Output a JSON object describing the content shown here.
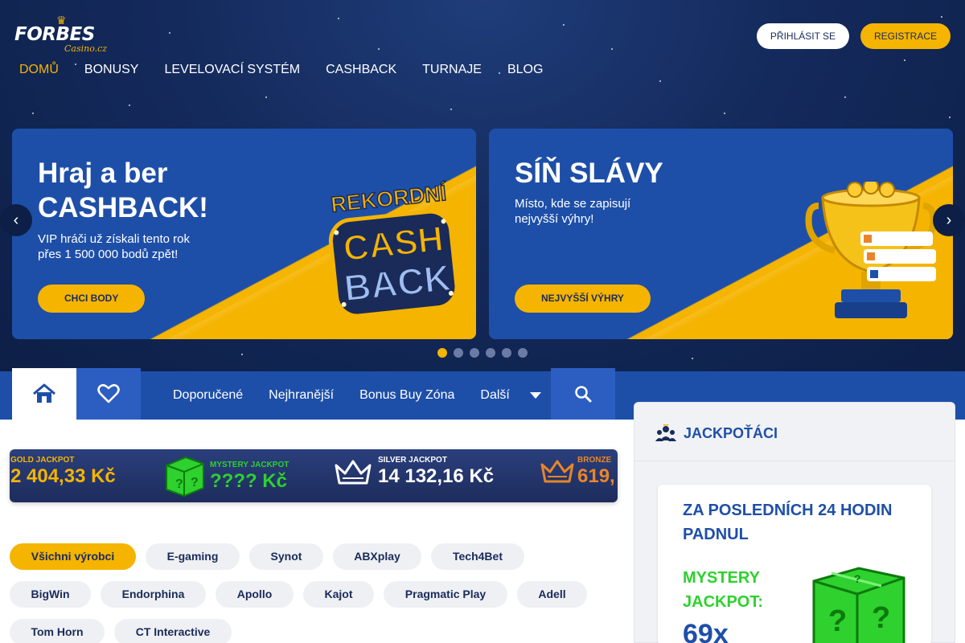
{
  "header": {
    "logo_brand": "FORBES",
    "logo_sub": "Casino.cz",
    "login_label": "PŘIHLÁSIT SE",
    "register_label": "REGISTRACE"
  },
  "nav": {
    "items": [
      "DOMŮ",
      "BONUSY",
      "LEVELOVACÍ SYSTÉM",
      "CASHBACK",
      "TURNAJE",
      "BLOG"
    ],
    "active": "DOMŮ"
  },
  "banners": [
    {
      "title_line1": "Hraj a ber",
      "title_line2": "CASHBACK!",
      "text_line1": "VIP hráči už získali tento rok",
      "text_line2": "přes 1 500 000 bodů zpět!",
      "cta": "CHCI BODY",
      "art_text_top": "REKORDNÍ",
      "art_text_mid": "CASH",
      "art_text_bot": "BACK"
    },
    {
      "title_line1": "SÍŇ SLÁVY",
      "text_line1": "Místo, kde se zapisují",
      "text_line2": "nejvyšší výhry!",
      "cta": "NEJVYŠŠÍ VÝHRY"
    }
  ],
  "carousel": {
    "dot_count": 6,
    "active_index": 0
  },
  "categories": {
    "links": [
      "Doporučené",
      "Nejhranější",
      "Bonus Buy Zóna"
    ],
    "more_label": "Další"
  },
  "jackpots": [
    {
      "label": "GOLD JACKPOT",
      "value": "2 404,33 Kč",
      "label_color": "#f5b400",
      "value_color": "#f5b400"
    },
    {
      "label": "MYSTERY JACKPOT",
      "value": "???? Kč",
      "label_color": "#2ed12e",
      "value_color": "#2ed12e"
    },
    {
      "label": "SILVER JACKPOT",
      "value": "14 132,16 Kč",
      "label_color": "#ffffff",
      "value_color": "#ffffff"
    },
    {
      "label": "BRONZE",
      "value": "619,",
      "label_color": "#e8852a",
      "value_color": "#e8852a"
    }
  ],
  "providers": {
    "row1": [
      "Všichni výrobci",
      "E-gaming",
      "Synot",
      "ABXplay",
      "Tech4Bet"
    ],
    "row2": [
      "BigWin",
      "Endorphina",
      "Apollo",
      "Kajot",
      "Pragmatic Play",
      "Adell"
    ],
    "row3": [
      "Tom Horn",
      "CT Interactive"
    ],
    "active": "Všichni výrobci"
  },
  "jackpot_panel": {
    "title": "JACKPOŤÁCI",
    "card_heading": "ZA POSLEDNÍCH 24 HODIN PADNUL",
    "jackpot_name": "MYSTERY JACKPOT:",
    "multiplier": "69x"
  },
  "colors": {
    "accent": "#f5b400",
    "brand_blue": "#1e4fa8",
    "hero_dark": "#142a5c",
    "mystery_green": "#2ed12e"
  }
}
